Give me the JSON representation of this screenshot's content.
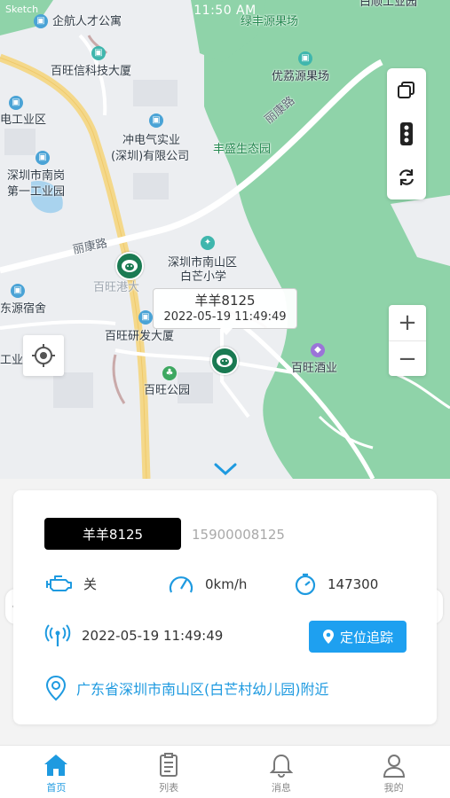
{
  "status_bar": {
    "time": "11:50 AM",
    "left": "Sketch"
  },
  "map": {
    "pois": {
      "qihang": "企航人才公寓",
      "lvfeng": "绿丰源果场",
      "baiwangxin": "百旺信科技大厦",
      "youlizhi": "优荔源果场",
      "dian_gongye": "电工业区",
      "chongdian": "冲电气实业",
      "chongdian2": "(深圳)有限公司",
      "fengsheng": "丰盛生态园",
      "nangang": "深圳市南岗",
      "nangang2": "第一工业园",
      "likang_road_1": "丽康路",
      "likang_road_2": "丽康路",
      "nanshan": "深圳市南山区",
      "baimang_school": "白芒小学",
      "baiwang_hidden": "百旺港大",
      "dongyuan": "东源宿舍",
      "yanfa": "百旺研发大厦",
      "gongye": "工业区",
      "jiuye": "百旺酒业",
      "park": "百旺公园",
      "top_right": "白顺工业园"
    }
  },
  "marker": {
    "name": "羊羊8125",
    "time": "2022-05-19 11:49:49"
  },
  "zoom": {
    "in": "+",
    "out": "−"
  },
  "vehicle": {
    "plate": "羊羊8125",
    "phone": "15900008125",
    "engine": "关",
    "speed": "0km/h",
    "mileage": "147300",
    "signal_time": "2022-05-19 11:49:49",
    "track_button": "定位追踪",
    "address": "广东省深圳市南山区(白芒村幼儿园)附近"
  },
  "tabs": [
    {
      "label": "首页",
      "icon": "home-icon",
      "active": true
    },
    {
      "label": "列表",
      "icon": "list-icon",
      "active": false
    },
    {
      "label": "消息",
      "icon": "bell-icon",
      "active": false
    },
    {
      "label": "我的",
      "icon": "user-icon",
      "active": false
    }
  ],
  "colors": {
    "accent": "#1e9ae0",
    "marker": "#1a7a52",
    "green_area": "#8fd3a9"
  }
}
